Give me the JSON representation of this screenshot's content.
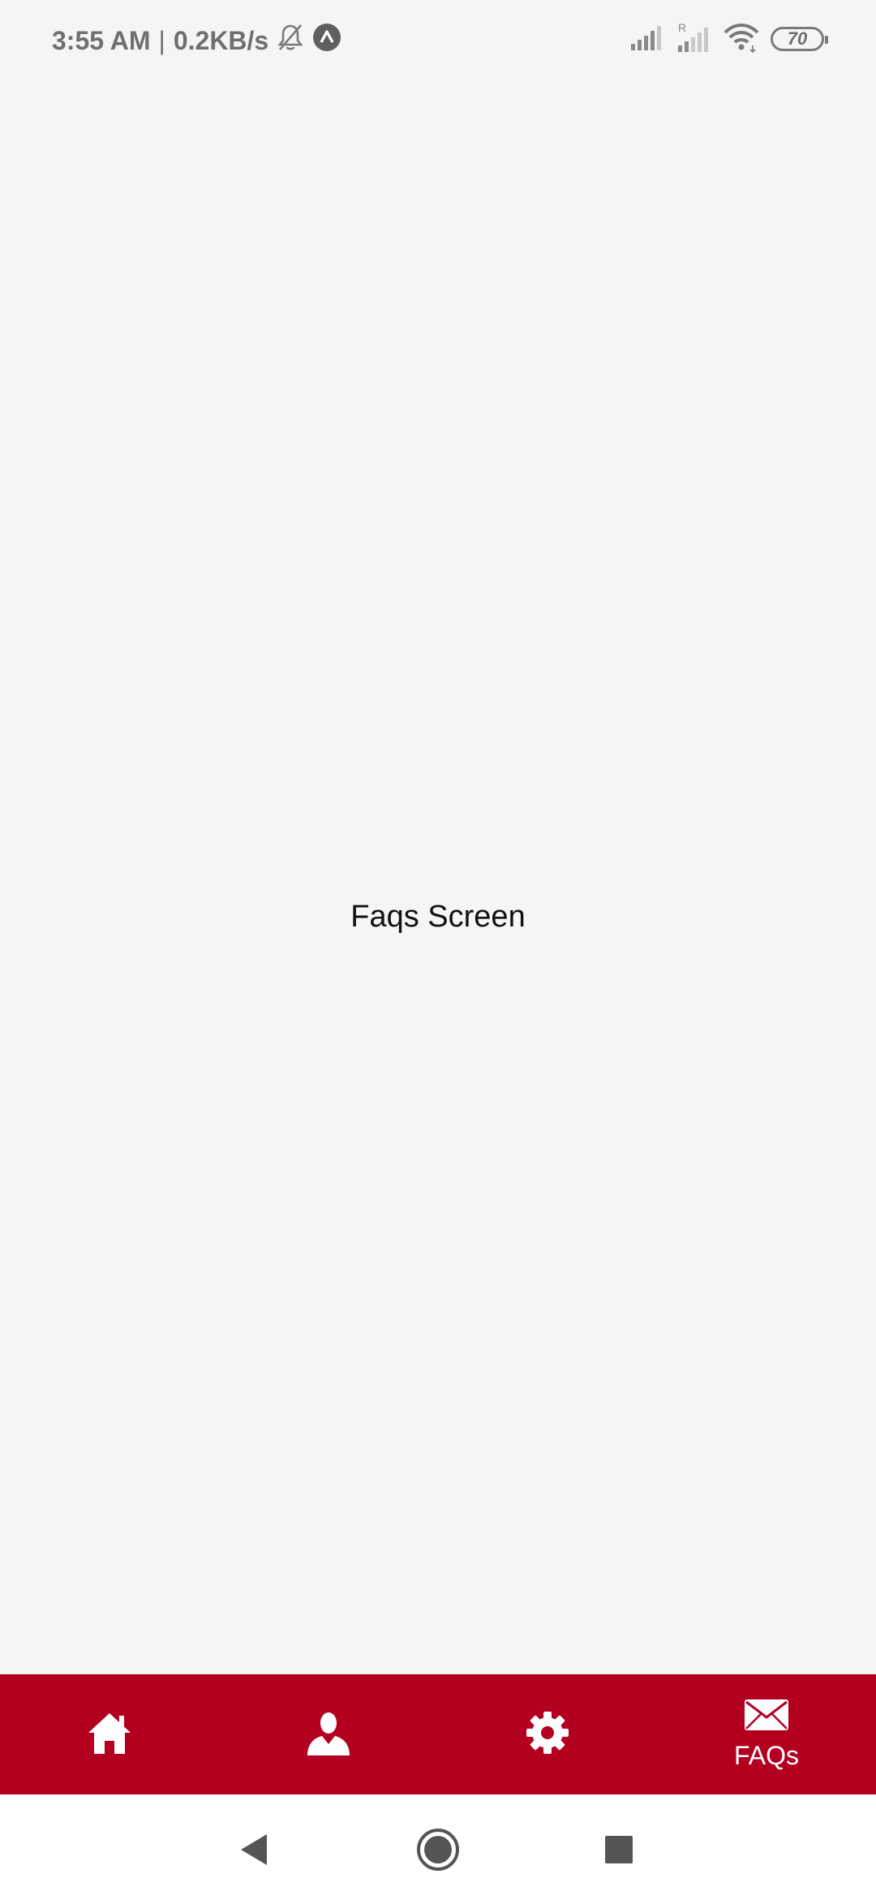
{
  "status_bar": {
    "time": "3:55 AM",
    "separator": "|",
    "network_speed": "0.2KB/s",
    "battery_level": "70",
    "icons": [
      "bell-off-icon",
      "app-notification-icon",
      "signal-icon",
      "roaming-signal-icon",
      "wifi-icon",
      "battery-icon"
    ]
  },
  "main": {
    "title": "Faqs Screen"
  },
  "tab_bar": {
    "background_color": "#b30021",
    "tabs": [
      {
        "icon": "home-icon",
        "label": ""
      },
      {
        "icon": "user-icon",
        "label": ""
      },
      {
        "icon": "gear-icon",
        "label": ""
      },
      {
        "icon": "envelope-icon",
        "label": "FAQs"
      }
    ],
    "active_tab": "FAQs"
  },
  "nav_bar": {
    "buttons": [
      "back-icon",
      "home-circle-icon",
      "recents-icon"
    ]
  }
}
